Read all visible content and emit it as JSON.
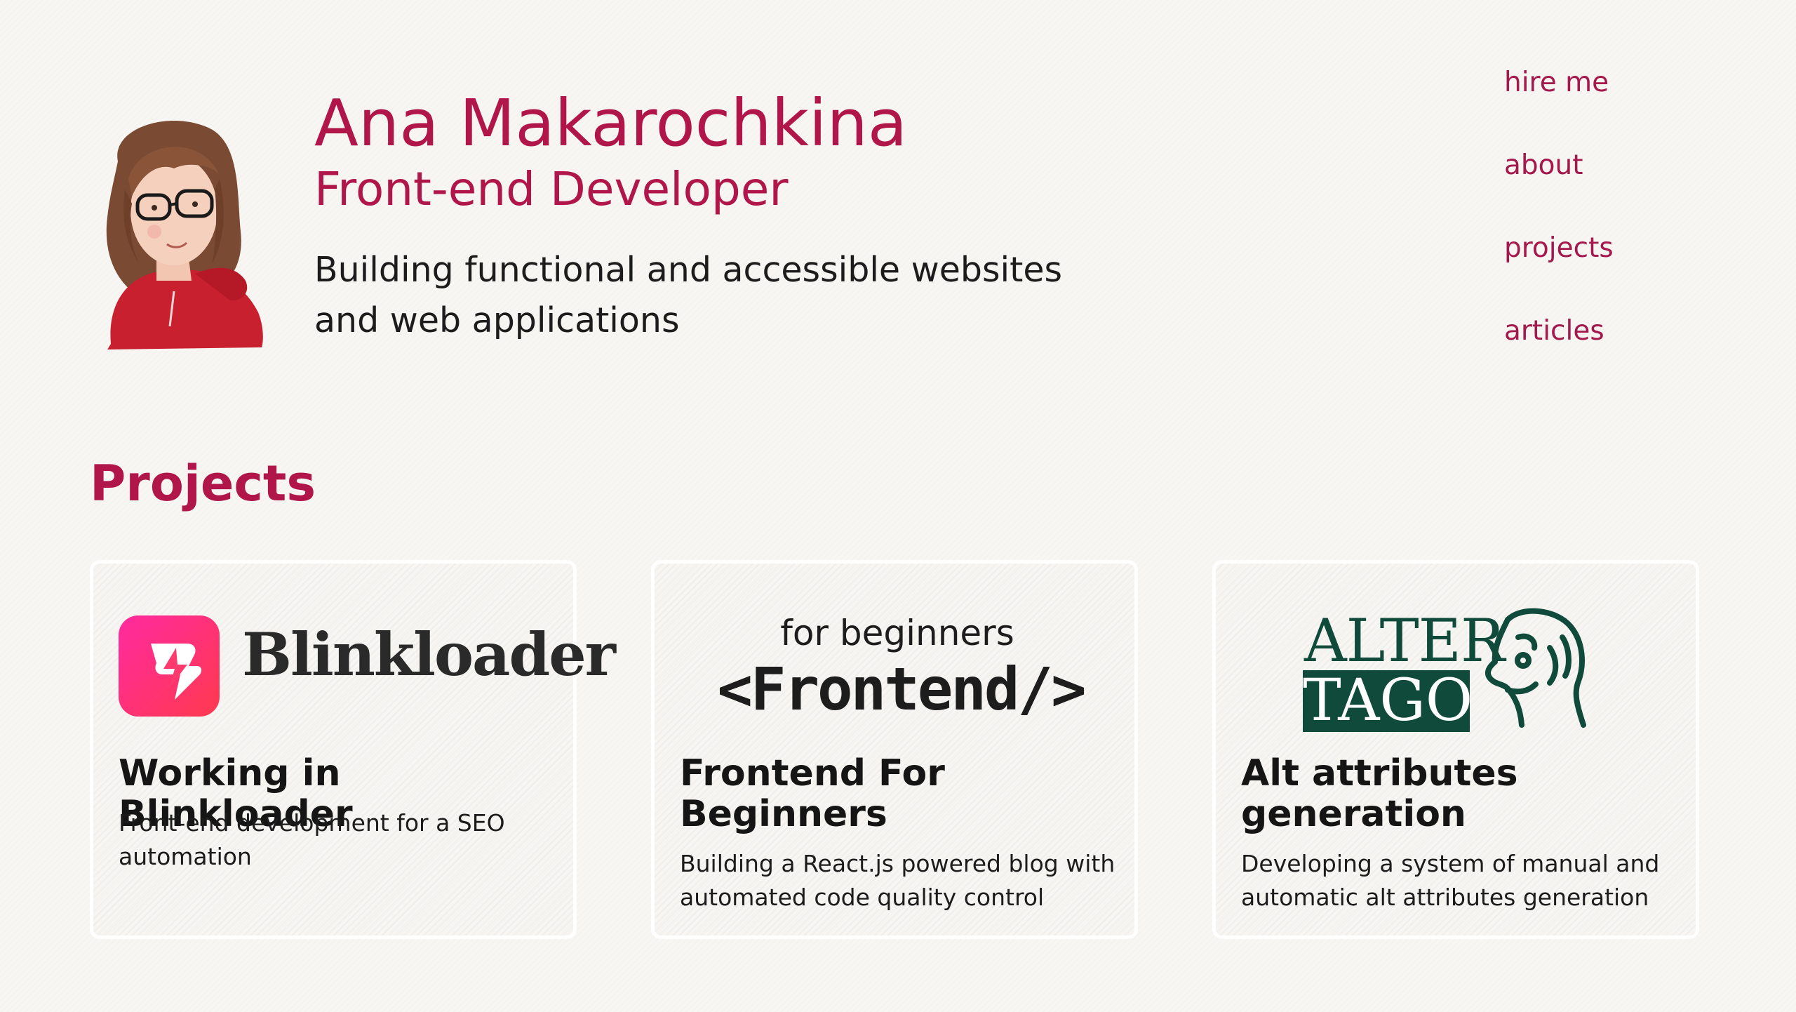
{
  "header": {
    "name": "Ana Makarochkina",
    "role": "Front-end Developer",
    "tagline": "Building functional and accessible websites and web applications"
  },
  "nav": {
    "items": [
      {
        "label": "hire me"
      },
      {
        "label": "about"
      },
      {
        "label": "projects"
      },
      {
        "label": "articles"
      }
    ]
  },
  "projects": {
    "title": "Projects",
    "cards": [
      {
        "logo_text": "Blinkloader",
        "title": "Working in Blinkloader",
        "description": "Front-end development for a SEO automation"
      },
      {
        "logo_small": "for beginners",
        "logo_big": "<Frontend/>",
        "title": "Frontend For Beginners",
        "description": "Building a React.js powered blog with automated code quality control"
      },
      {
        "logo_top": "ALTER",
        "logo_bottom": "TAGO",
        "title": "Alt attributes generation",
        "description": "Developing a system of manual and automatic alt attributes generation"
      }
    ]
  },
  "colors": {
    "accent": "#b0164a",
    "background": "#f7f6f3",
    "alter_tago_green": "#0f4a3a",
    "blinkloader_gradient": [
      "#ff2aa0",
      "#ff3a4f"
    ]
  },
  "icons": {
    "avatar": "illustrated-portrait",
    "blinkloader": "lightning-icon",
    "alter_tago": "face-profile-icon"
  }
}
